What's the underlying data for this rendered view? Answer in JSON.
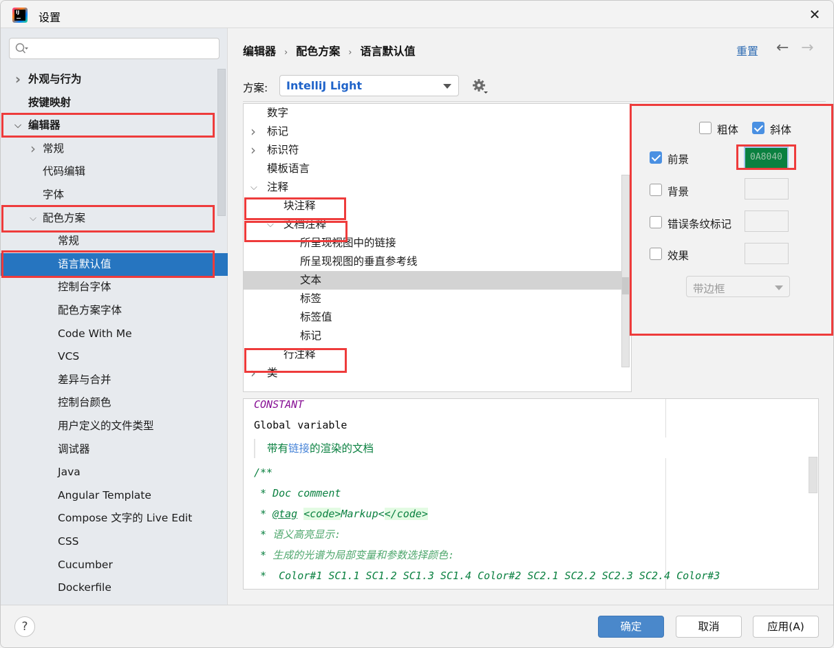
{
  "window": {
    "title": "设置"
  },
  "sidebar": {
    "search": {
      "placeholder": "",
      "value": ""
    },
    "items": [
      {
        "label": "外观与行为",
        "level": 0,
        "chevron": "right",
        "bold": true
      },
      {
        "label": "按键映射",
        "level": 0,
        "chevron": "",
        "bold": true
      },
      {
        "label": "编辑器",
        "level": 0,
        "chevron": "down",
        "bold": true
      },
      {
        "label": "常规",
        "level": 1,
        "chevron": "right"
      },
      {
        "label": "代码编辑",
        "level": 1,
        "chevron": ""
      },
      {
        "label": "字体",
        "level": 1,
        "chevron": ""
      },
      {
        "label": "配色方案",
        "level": 1,
        "chevron": "down"
      },
      {
        "label": "常规",
        "level": 2,
        "chevron": ""
      },
      {
        "label": "语言默认值",
        "level": 2,
        "chevron": "",
        "selected": true
      },
      {
        "label": "控制台字体",
        "level": 2,
        "chevron": ""
      },
      {
        "label": "配色方案字体",
        "level": 2,
        "chevron": ""
      },
      {
        "label": "Code With Me",
        "level": 2,
        "chevron": ""
      },
      {
        "label": "VCS",
        "level": 2,
        "chevron": ""
      },
      {
        "label": "差异与合并",
        "level": 2,
        "chevron": ""
      },
      {
        "label": "控制台颜色",
        "level": 2,
        "chevron": ""
      },
      {
        "label": "用户定义的文件类型",
        "level": 2,
        "chevron": ""
      },
      {
        "label": "调试器",
        "level": 2,
        "chevron": ""
      },
      {
        "label": "Java",
        "level": 2,
        "chevron": ""
      },
      {
        "label": "Angular Template",
        "level": 2,
        "chevron": ""
      },
      {
        "label": "Compose 文字的 Live Edit",
        "level": 2,
        "chevron": ""
      },
      {
        "label": "CSS",
        "level": 2,
        "chevron": ""
      },
      {
        "label": "Cucumber",
        "level": 2,
        "chevron": ""
      },
      {
        "label": "Dockerfile",
        "level": 2,
        "chevron": ""
      }
    ]
  },
  "header": {
    "breadcrumb": [
      "编辑器",
      "配色方案",
      "语言默认值"
    ],
    "breadcrumb_sep": "›",
    "reset_label": "重置",
    "back_icon": "←",
    "forward_icon": "→"
  },
  "scheme": {
    "label": "方案:",
    "value": "IntelliJ Light"
  },
  "attributes_tree": [
    {
      "label": "数字",
      "level": 0,
      "chevron": ""
    },
    {
      "label": "标记",
      "level": 0,
      "chevron": "right"
    },
    {
      "label": "标识符",
      "level": 0,
      "chevron": "right"
    },
    {
      "label": "模板语言",
      "level": 0,
      "chevron": ""
    },
    {
      "label": "注释",
      "level": 0,
      "chevron": "down"
    },
    {
      "label": "块注释",
      "level": 1,
      "chevron": ""
    },
    {
      "label": "文档注释",
      "level": 1,
      "chevron": "down"
    },
    {
      "label": "所呈现视图中的链接",
      "level": 2,
      "chevron": ""
    },
    {
      "label": "所呈现视图的垂直参考线",
      "level": 2,
      "chevron": ""
    },
    {
      "label": "文本",
      "level": 2,
      "chevron": "",
      "highlighted": true
    },
    {
      "label": "标签",
      "level": 2,
      "chevron": ""
    },
    {
      "label": "标签值",
      "level": 2,
      "chevron": ""
    },
    {
      "label": "标记",
      "level": 2,
      "chevron": ""
    },
    {
      "label": "行注释",
      "level": 1,
      "chevron": ""
    },
    {
      "label": "类",
      "level": 0,
      "chevron": "right"
    }
  ],
  "properties": {
    "bold": {
      "label": "粗体",
      "checked": false
    },
    "italic": {
      "label": "斜体",
      "checked": true
    },
    "foreground": {
      "label": "前景",
      "checked": true,
      "color": "0A8040",
      "color_hex": "#0a8040"
    },
    "background": {
      "label": "背景",
      "checked": false
    },
    "error_stripe": {
      "label": "错误条纹标记",
      "checked": false
    },
    "effects": {
      "label": "效果",
      "checked": false
    },
    "effect_type": {
      "value": "带边框"
    }
  },
  "preview": {
    "constant": "CONSTANT",
    "global_variable": "Global variable",
    "rendered_doc": {
      "before": "带有",
      "link": "链接",
      "after": "的渲染的文档"
    },
    "doc_open": "/**",
    "doc_comment": "Doc comment",
    "tag": "@tag",
    "markup_open": "<code>",
    "markup_text": "Markup",
    "markup_close": "</code>",
    "semantic": "语义高亮显示:",
    "spectrum": "生成的光谱为局部变量和参数选择颜色:",
    "colors": "Color#1 SC1.1 SC1.2 SC1.3 SC1.4 Color#2 SC2.1 SC2.2 SC2.3 SC2.4 Color#3",
    "star": "*"
  },
  "footer": {
    "help": "?",
    "ok": "确定",
    "cancel": "取消",
    "apply": "应用(A)"
  }
}
